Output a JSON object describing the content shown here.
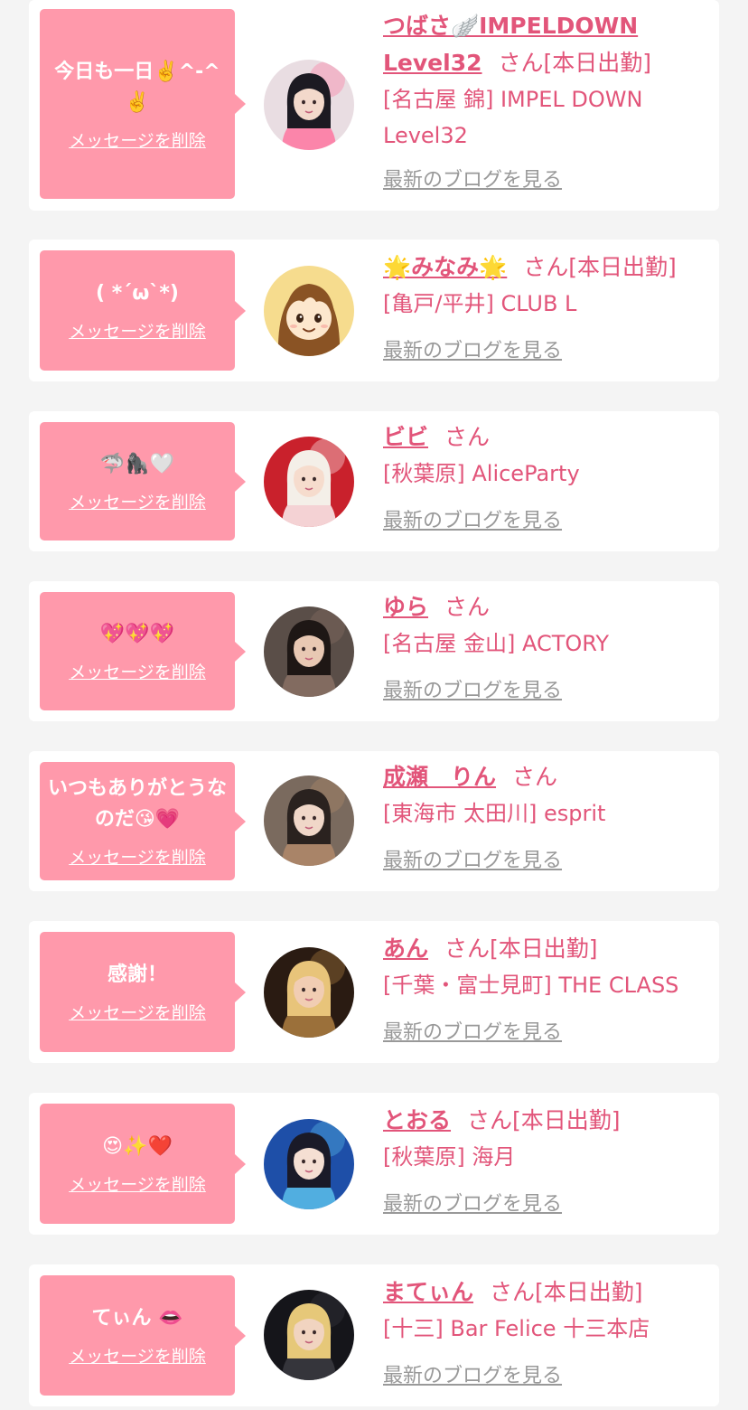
{
  "ui": {
    "delete_label": "メッセージを削除",
    "blog_label": "最新のブログを見る",
    "honorific": "さん",
    "on_duty_label": "[本日出勤]"
  },
  "colors": {
    "bubble": "#ff99ab",
    "name": "#e2557a",
    "link_gray": "#999999",
    "card": "#ffffff",
    "page_bg": "#f4f4f4"
  },
  "entries": [
    {
      "message": "今日も一日✌️^-^✌️",
      "name": "つばさ🪽IMPELDOWN Level32",
      "on_duty": true,
      "shop": "[名古屋 錦] IMPEL DOWN Level32",
      "avatar_icon": "avatar-photo-icon"
    },
    {
      "message": "( *´ω`*)",
      "name": "🌟みなみ🌟",
      "on_duty": true,
      "shop": "[亀戸/平井] CLUB L",
      "avatar_icon": "avatar-cartoon-icon"
    },
    {
      "message": "🦈🦍🤍",
      "name": "ビビ",
      "on_duty": false,
      "shop": "[秋葉原] AliceParty",
      "avatar_icon": "avatar-photo-icon"
    },
    {
      "message": "💖💖💖",
      "name": "ゆら",
      "on_duty": false,
      "shop": "[名古屋 金山] ACTORY",
      "avatar_icon": "avatar-photo-icon"
    },
    {
      "message": "いつもありがとうなのだ😘💗",
      "name": "成瀬　りん",
      "on_duty": false,
      "shop": "[東海市 太田川] esprit",
      "avatar_icon": "avatar-photo-icon"
    },
    {
      "message": "感謝！",
      "name": "あん",
      "on_duty": true,
      "shop": "[千葉・富士見町] THE CLASS",
      "avatar_icon": "avatar-photo-icon"
    },
    {
      "message": "😍✨❤️",
      "name": "とおる",
      "on_duty": true,
      "shop": "[秋葉原] 海月",
      "avatar_icon": "avatar-photo-icon"
    },
    {
      "message": "てぃん 👄",
      "name": "まてぃん",
      "on_duty": true,
      "shop": "[十三] Bar Felice 十三本店",
      "avatar_icon": "avatar-photo-icon"
    }
  ]
}
